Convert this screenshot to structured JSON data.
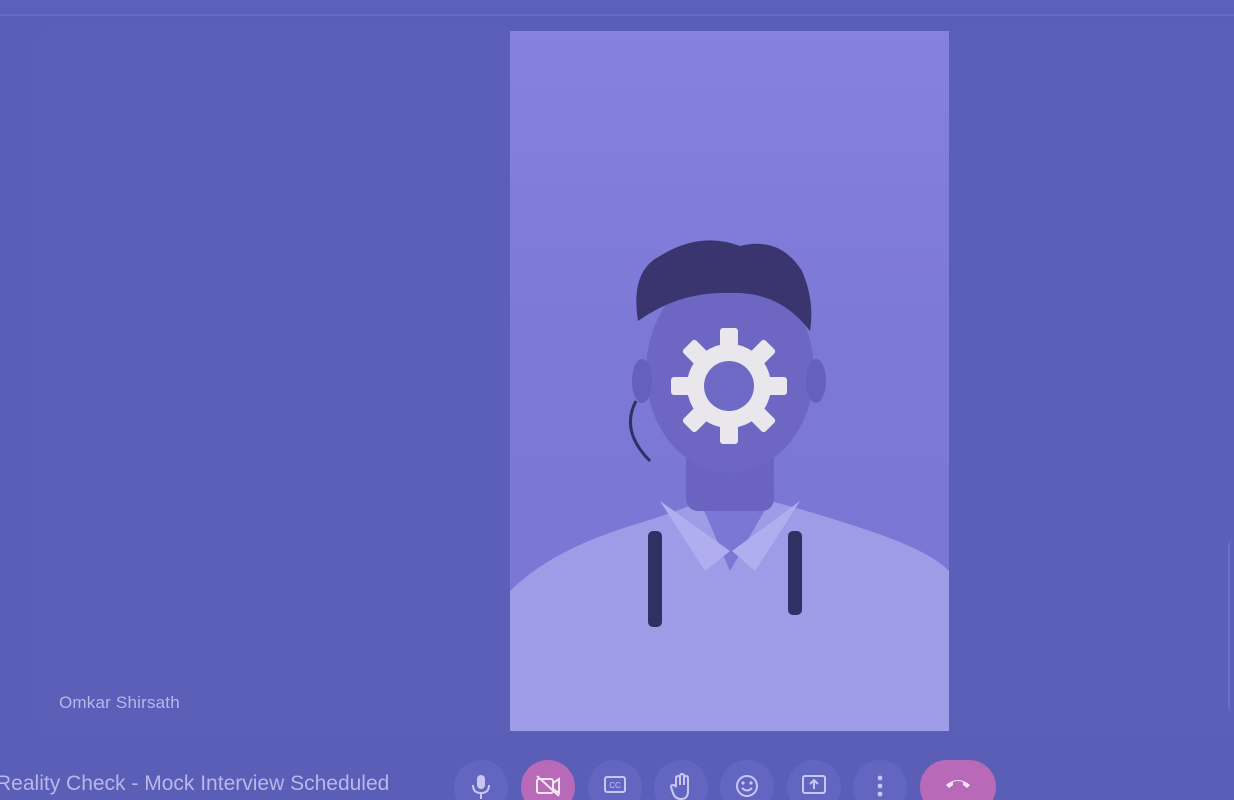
{
  "participant": {
    "name": "Omkar Shirsath"
  },
  "meeting": {
    "title": "Reality Check - Mock Interview Scheduled"
  },
  "overlay": {
    "icon": "gear-icon"
  },
  "controls": [
    {
      "id": "mic",
      "icon": "mic-icon"
    },
    {
      "id": "camera",
      "icon": "camera-off-icon",
      "state": "off"
    },
    {
      "id": "captions",
      "icon": "captions-icon"
    },
    {
      "id": "raise_hand",
      "icon": "hand-icon"
    },
    {
      "id": "reactions",
      "icon": "emoji-icon"
    },
    {
      "id": "present",
      "icon": "present-screen-icon"
    },
    {
      "id": "more",
      "icon": "more-vert-icon"
    },
    {
      "id": "leave",
      "icon": "end-call-icon"
    }
  ],
  "colors": {
    "background": "#5a5eb6",
    "video_tint": "#7c78d6",
    "danger": "#b86ab8",
    "control": "#6266c0"
  }
}
